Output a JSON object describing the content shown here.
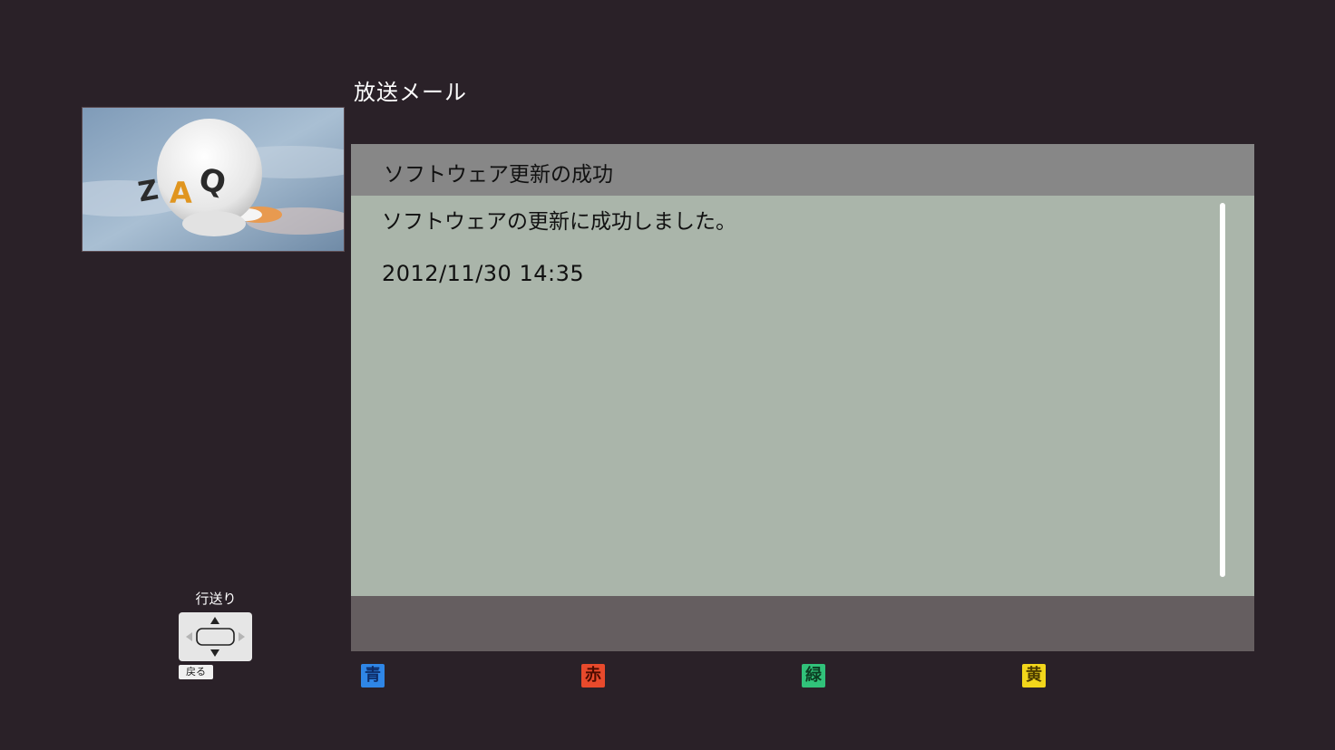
{
  "header": {
    "title": "放送メール"
  },
  "thumbnail": {
    "logo_text": "ZAQ"
  },
  "mail": {
    "subject": "ソフトウェア更新の成功",
    "body": "ソフトウェアの更新に成功しました。",
    "date": "2012/11/30  14:35"
  },
  "color_keys": {
    "blue": "青",
    "red": "赤",
    "green": "緑",
    "yellow": "黄"
  },
  "controls": {
    "scroll_hint": "行送り",
    "back": "戻る"
  },
  "colors": {
    "background": "#2a2128",
    "panel": "#aab5aa",
    "header": "#878787",
    "footer": "#655e60",
    "blue": "#2f86e6",
    "red": "#e84a2c",
    "green": "#31c27a",
    "yellow": "#f2d61b"
  }
}
